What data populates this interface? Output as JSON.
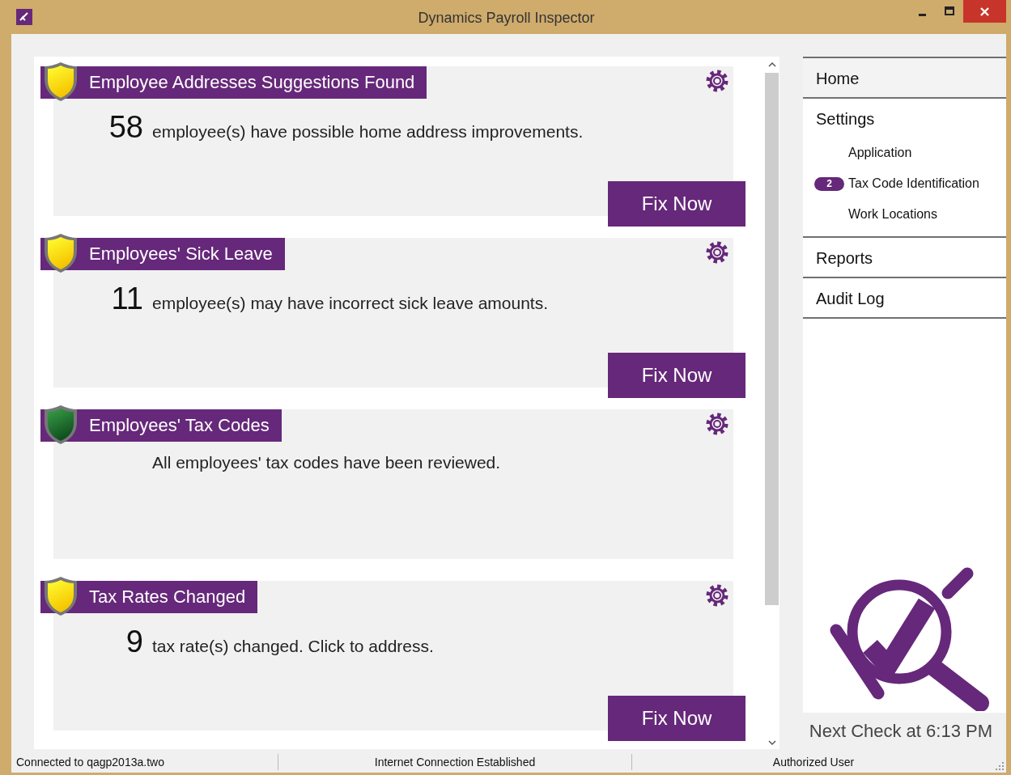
{
  "window": {
    "title": "Dynamics Payroll Inspector"
  },
  "cards": [
    {
      "kind": "warning",
      "title": "Employee Addresses Suggestions Found",
      "count": "58",
      "message": "employee(s) have possible home address improvements.",
      "button": "Fix Now"
    },
    {
      "kind": "warning",
      "title": "Employees' Sick Leave",
      "count": "11",
      "message": "employee(s) may have incorrect sick leave amounts.",
      "button": "Fix Now"
    },
    {
      "kind": "ok",
      "title": "Employees' Tax Codes",
      "message": "All employees' tax codes have been reviewed."
    },
    {
      "kind": "warning",
      "title": "Tax Rates Changed",
      "count": "9",
      "message": "tax rate(s) changed. Click to address.",
      "button": "Fix Now"
    }
  ],
  "nav": [
    {
      "label": "Home",
      "selected": true
    },
    {
      "label": "Settings",
      "selected": false,
      "children": [
        {
          "label": "Application",
          "selected": false
        },
        {
          "label": "Tax Code Identification",
          "badge": "2",
          "selected": false
        },
        {
          "label": "Work Locations",
          "selected": false
        }
      ]
    },
    {
      "label": "Reports",
      "selected": false
    },
    {
      "label": "Audit Log",
      "selected": false
    }
  ],
  "next_check": "Next Check at 6:13 PM",
  "status_bar": [
    "Connected to qagp2013a.two",
    "Internet Connection Established",
    "Authorized User"
  ]
}
